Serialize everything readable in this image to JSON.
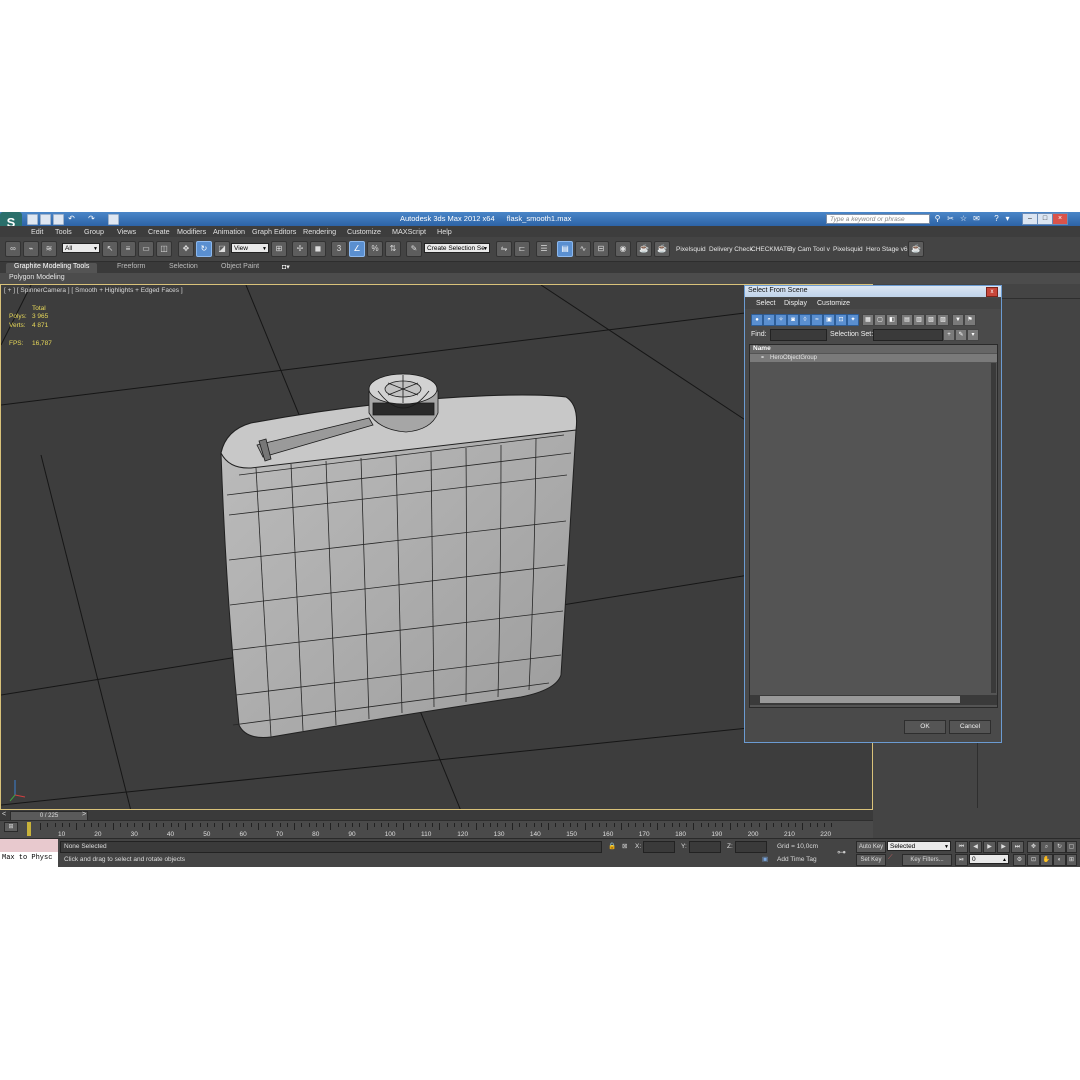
{
  "window": {
    "app_title": "Autodesk 3ds Max  2012 x64",
    "file_name": "flask_smooth1.max",
    "search_placeholder": "Type a keyword or phrase"
  },
  "menu": [
    "Edit",
    "Tools",
    "Group",
    "Views",
    "Create",
    "Modifiers",
    "Animation",
    "Graph Editors",
    "Rendering",
    "Customize",
    "MAXScript",
    "Help"
  ],
  "toolbar": {
    "selection_filter": "All",
    "ref_coord": "View",
    "named_selection": "Create Selection Se",
    "angle_snap": "3",
    "percent_snap": "%",
    "extensions": [
      "Pixelsquid",
      "Delivery Check",
      "CHECKMATE",
      "uty Cam Tool v",
      "Pixelsquid",
      "Hero Stage v6"
    ]
  },
  "ribbon": {
    "tabs": [
      "Graphite Modeling Tools",
      "Freeform",
      "Selection",
      "Object Paint"
    ],
    "active_panel": "Polygon Modeling"
  },
  "viewport": {
    "label": "[ + ] [ SpinnerCamera ] [ Smooth + Highlights + Edged Faces ]",
    "stats": {
      "total_label": "Total",
      "polys_label": "Polys:",
      "polys_value": "3 965",
      "verts_label": "Verts:",
      "verts_value": "4 871",
      "fps_label": "FPS:",
      "fps_value": "16,787"
    }
  },
  "dialog": {
    "title": "Select From Scene",
    "menu": [
      "Select",
      "Display",
      "Customize"
    ],
    "find_label": "Find:",
    "selection_set_label": "Selection Set:",
    "column_name": "Name",
    "items": [
      "HeroObjectGroup"
    ],
    "ok_label": "OK",
    "cancel_label": "Cancel"
  },
  "timeline": {
    "frame_display": "0 / 225",
    "ticks": [
      "10",
      "20",
      "30",
      "40",
      "50",
      "60",
      "70",
      "80",
      "90",
      "100",
      "110",
      "120",
      "130",
      "140",
      "150",
      "160",
      "170",
      "180",
      "190",
      "200",
      "210",
      "220"
    ],
    "nav_prev": "<",
    "nav_next": ">"
  },
  "status": {
    "maxscript_label": "Max to Physc",
    "selection_text": "None Selected",
    "prompt_text": "Click and drag to select and rotate objects",
    "x_label": "X:",
    "y_label": "Y:",
    "z_label": "Z:",
    "grid_text": "Grid = 10,0cm",
    "add_time_tag": "Add Time Tag",
    "auto_key": "Auto Key",
    "set_key": "Set Key",
    "selected_value": "Selected",
    "key_filters": "Key Filters...",
    "current_frame": "0"
  }
}
